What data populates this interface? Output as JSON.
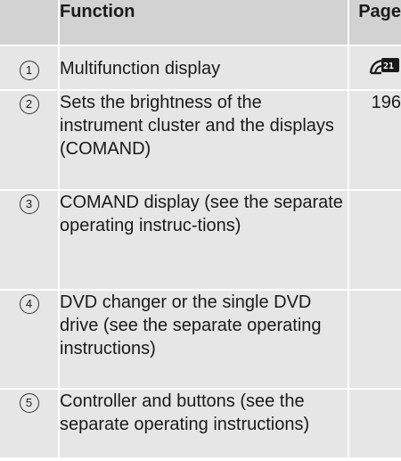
{
  "header": {
    "number": "",
    "function": "Function",
    "page": "Page"
  },
  "rows": [
    {
      "number": "1",
      "function": "Multifunction display",
      "page": "",
      "page_icon": "instrument-cluster-icon"
    },
    {
      "number": "2",
      "function": "Sets the brightness of the instrument cluster and the displays (COMAND)",
      "page": "196"
    },
    {
      "number": "3",
      "function": "COMAND display (see the separate operating instruc-tions)",
      "page": ""
    },
    {
      "number": "4",
      "function": "DVD changer or the single DVD drive (see the separate operating instructions)",
      "page": ""
    },
    {
      "number": "5",
      "function": "Controller and buttons (see the separate operating instructions)",
      "page": ""
    }
  ]
}
